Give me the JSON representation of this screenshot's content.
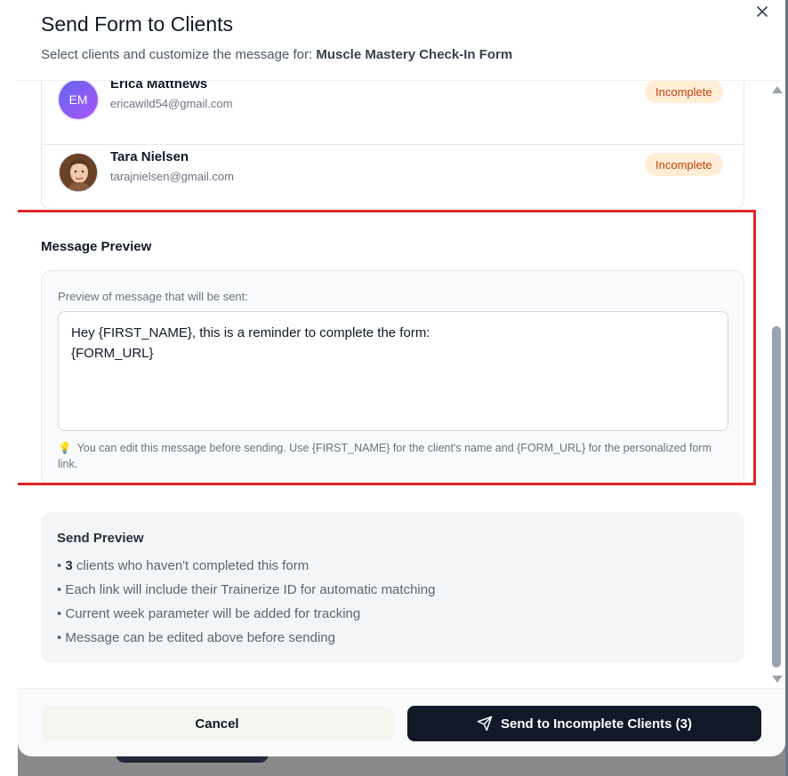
{
  "modal": {
    "title": "Send Form to Clients",
    "subtitle_prefix": "Select clients and customize the message for: ",
    "form_name": "Muscle Mastery Check-In Form"
  },
  "clients": [
    {
      "initials": "EM",
      "name": "Erica Matthews",
      "email": "ericawild54@gmail.com",
      "status": "Incomplete"
    },
    {
      "initials": "",
      "name": "Tara Nielsen",
      "email": "tarajnielsen@gmail.com",
      "status": "Incomplete"
    }
  ],
  "message_preview": {
    "heading": "Message Preview",
    "label": "Preview of message that will be sent:",
    "message": "Hey {FIRST_NAME}, this is a reminder to complete the form:\n{FORM_URL}",
    "hint": "You can edit this message before sending. Use {FIRST_NAME} for the client's name and {FORM_URL} for the personalized form link.",
    "hint_icon": "lightbulb-icon"
  },
  "send_preview": {
    "heading": "Send Preview",
    "count": "3",
    "items": [
      " clients who haven't completed this form",
      "Each link will include their Trainerize ID for automatic matching",
      "Current week parameter will be added for tracking",
      "Message can be edited above before sending"
    ]
  },
  "footer": {
    "cancel_label": "Cancel",
    "send_label": "Send to Incomplete Clients (3)",
    "send_icon": "send-icon"
  },
  "colors": {
    "badge_bg": "#ffedd5",
    "badge_text": "#c2410c",
    "primary_button": "#111827",
    "highlight": "#dc2626"
  }
}
